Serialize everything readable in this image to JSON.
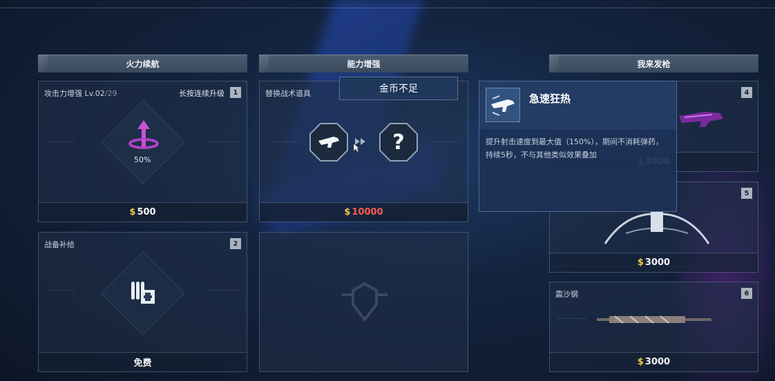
{
  "columns": {
    "firepower": {
      "header": "火力续航"
    },
    "ability": {
      "header": "能力增强"
    },
    "weapons": {
      "header": "我来发枪"
    }
  },
  "cards": {
    "attack_boost": {
      "title_prefix": "攻击力增强 Lv.",
      "level": "02",
      "level_max": "/29",
      "hint": "长按连续升级",
      "slot": "1",
      "percent": "50%",
      "currency_symbol": "$",
      "price": "500",
      "icon": "upgrade-arrow-icon"
    },
    "supply": {
      "title": "战备补给",
      "slot": "2",
      "price": "免费",
      "icon": "ammo-supply-icon"
    },
    "tactical": {
      "title": "替换战术道具",
      "currency_symbol": "$",
      "price": "10000",
      "price_color": "#ff5a4e",
      "from_icon": "rifle-icon",
      "to_icon": "question-icon",
      "question": "?"
    },
    "weapon4": {
      "slot": "4",
      "currency_symbol": "$",
      "price": "3000"
    },
    "weapon5": {
      "slot": "5",
      "currency_symbol": "$",
      "price": "3000"
    },
    "weapon6": {
      "name": "震沙钢",
      "slot": "6",
      "currency_symbol": "$",
      "price": "3000"
    }
  },
  "toast": {
    "text": "金币不足"
  },
  "tooltip": {
    "name": "急速狂热",
    "description": "提升射击速度到最大值（150%），期间不消耗弹药，持续5秒，不与其他类似效果叠加",
    "icon": "rapid-fire-icon"
  },
  "colors": {
    "currency": "#f3c94a",
    "insufficient": "#ff5a4e",
    "accent_purple": "#b040c8"
  }
}
